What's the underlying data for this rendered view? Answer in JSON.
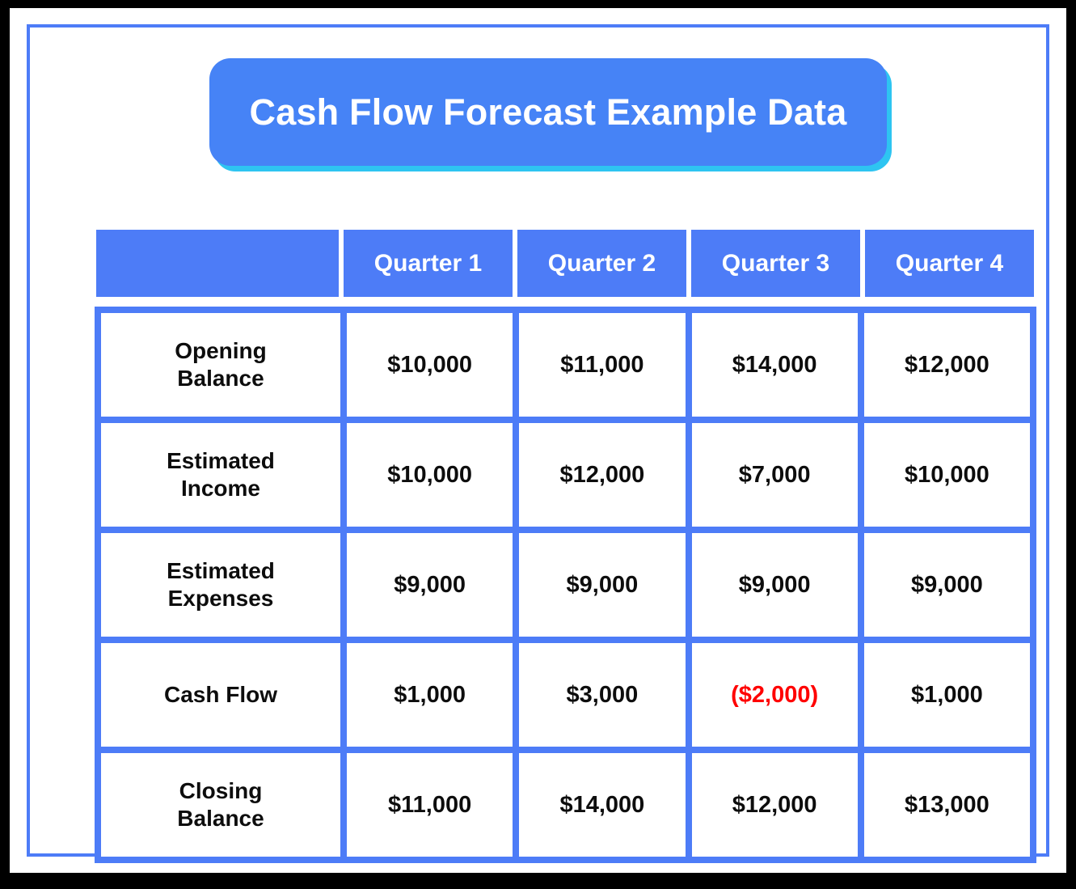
{
  "title": "Cash Flow Forecast Example Data",
  "colors": {
    "banner_fill": "#4683f6",
    "banner_shadow": "#2ec4f1",
    "grid_blue": "#4d7cf7",
    "negative_red": "#ff0000",
    "frame_black": "#000000",
    "cell_white": "#ffffff"
  },
  "table": {
    "columns": [
      {
        "label": ""
      },
      {
        "label": "Quarter 1"
      },
      {
        "label": "Quarter 2"
      },
      {
        "label": "Quarter 3"
      },
      {
        "label": "Quarter 4"
      }
    ],
    "rows": [
      {
        "label": "Opening\nBalance",
        "label_line1": "Opening",
        "label_line2": "Balance",
        "values": [
          {
            "text": "$10,000",
            "negative": false
          },
          {
            "text": "$11,000",
            "negative": false
          },
          {
            "text": "$14,000",
            "negative": false
          },
          {
            "text": "$12,000",
            "negative": false
          }
        ]
      },
      {
        "label": "Estimated\nIncome",
        "label_line1": "Estimated",
        "label_line2": "Income",
        "values": [
          {
            "text": "$10,000",
            "negative": false
          },
          {
            "text": "$12,000",
            "negative": false
          },
          {
            "text": "$7,000",
            "negative": false
          },
          {
            "text": "$10,000",
            "negative": false
          }
        ]
      },
      {
        "label": "Estimated\nExpenses",
        "label_line1": "Estimated",
        "label_line2": "Expenses",
        "values": [
          {
            "text": "$9,000",
            "negative": false
          },
          {
            "text": "$9,000",
            "negative": false
          },
          {
            "text": "$9,000",
            "negative": false
          },
          {
            "text": "$9,000",
            "negative": false
          }
        ]
      },
      {
        "label": "Cash Flow",
        "label_line1": "Cash Flow",
        "label_line2": "",
        "values": [
          {
            "text": "$1,000",
            "negative": false
          },
          {
            "text": "$3,000",
            "negative": false
          },
          {
            "text": "($2,000)",
            "negative": true
          },
          {
            "text": "$1,000",
            "negative": false
          }
        ]
      },
      {
        "label": "Closing\nBalance",
        "label_line1": "Closing",
        "label_line2": "Balance",
        "values": [
          {
            "text": "$11,000",
            "negative": false
          },
          {
            "text": "$14,000",
            "negative": false
          },
          {
            "text": "$12,000",
            "negative": false
          },
          {
            "text": "$13,000",
            "negative": false
          }
        ]
      }
    ]
  }
}
